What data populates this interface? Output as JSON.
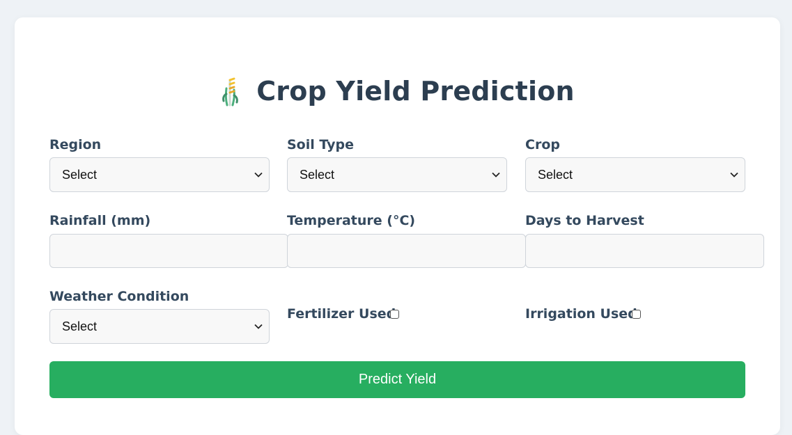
{
  "page": {
    "title": "Crop Yield Prediction",
    "icon": "sheaf-of-rice-icon"
  },
  "form": {
    "region": {
      "label": "Region",
      "value": "Select"
    },
    "soil_type": {
      "label": "Soil Type",
      "value": "Select"
    },
    "crop": {
      "label": "Crop",
      "value": "Select"
    },
    "rainfall": {
      "label": "Rainfall (mm)",
      "value": ""
    },
    "temperature": {
      "label": "Temperature (°C)",
      "value": ""
    },
    "days_to_harvest": {
      "label": "Days to Harvest",
      "value": ""
    },
    "weather_condition": {
      "label": "Weather Condition",
      "value": "Select"
    },
    "fertilizer_used": {
      "label": "Fertilizer Used",
      "checked": false
    },
    "irrigation_used": {
      "label": "Irrigation Used",
      "checked": false
    },
    "submit_label": "Predict Yield"
  },
  "colors": {
    "background": "#eef2f6",
    "card": "#ffffff",
    "title": "#2c3e50",
    "button": "#27ae60"
  }
}
